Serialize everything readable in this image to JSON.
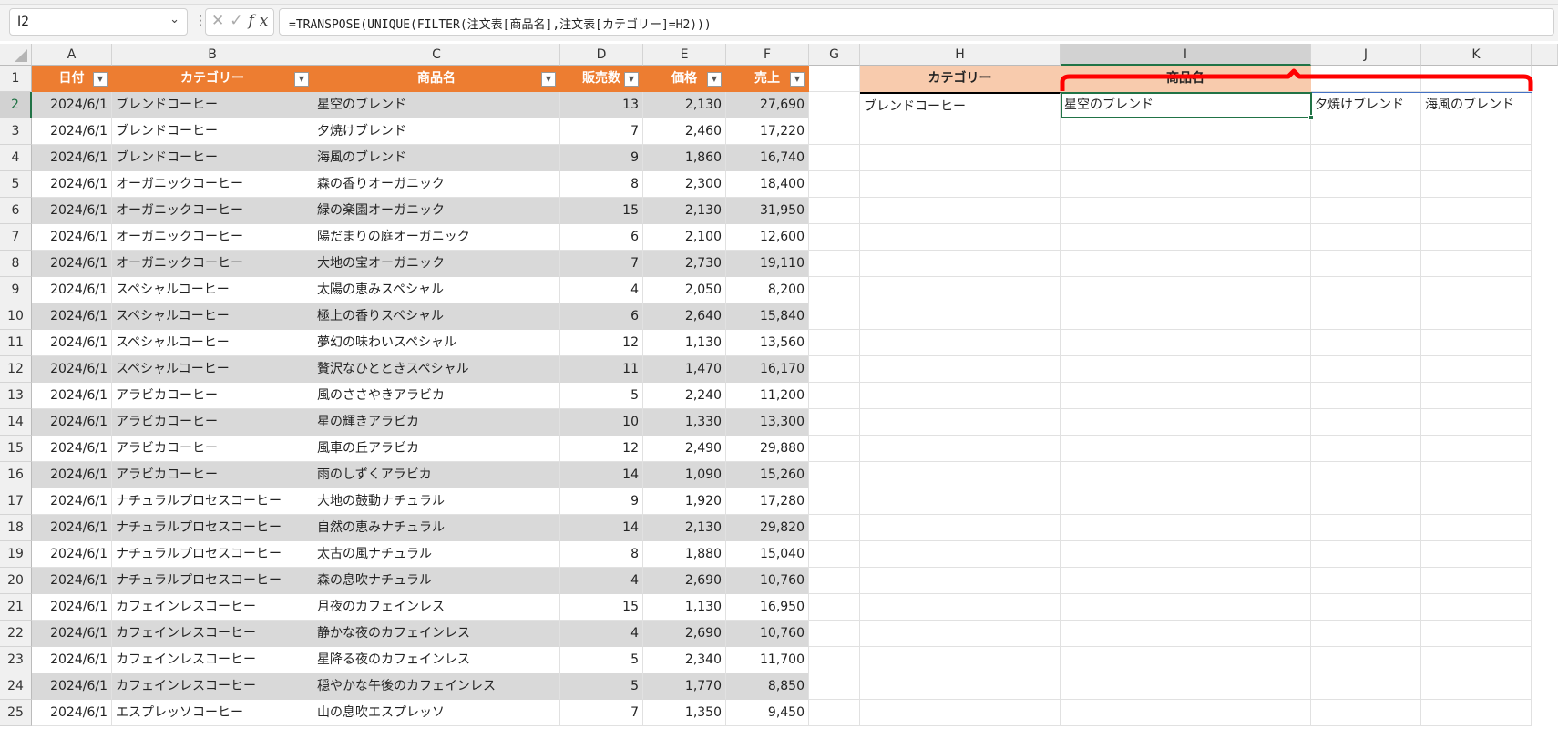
{
  "formula_bar": {
    "name_box": "I2",
    "formula": "=TRANSPOSE(UNIQUE(FILTER(注文表[商品名],注文表[カテゴリー]=H2)))",
    "fx": "fx"
  },
  "columns": [
    "A",
    "B",
    "C",
    "D",
    "E",
    "F",
    "G",
    "H",
    "I",
    "J",
    "K"
  ],
  "table": {
    "headers": [
      "日付",
      "カテゴリー",
      "商品名",
      "販売数",
      "価格",
      "売上"
    ],
    "rows": [
      [
        "2024/6/1",
        "ブレンドコーヒー",
        "星空のブレンド",
        "13",
        "2,130",
        "27,690"
      ],
      [
        "2024/6/1",
        "ブレンドコーヒー",
        "夕焼けブレンド",
        "7",
        "2,460",
        "17,220"
      ],
      [
        "2024/6/1",
        "ブレンドコーヒー",
        "海風のブレンド",
        "9",
        "1,860",
        "16,740"
      ],
      [
        "2024/6/1",
        "オーガニックコーヒー",
        "森の香りオーガニック",
        "8",
        "2,300",
        "18,400"
      ],
      [
        "2024/6/1",
        "オーガニックコーヒー",
        "緑の楽園オーガニック",
        "15",
        "2,130",
        "31,950"
      ],
      [
        "2024/6/1",
        "オーガニックコーヒー",
        "陽だまりの庭オーガニック",
        "6",
        "2,100",
        "12,600"
      ],
      [
        "2024/6/1",
        "オーガニックコーヒー",
        "大地の宝オーガニック",
        "7",
        "2,730",
        "19,110"
      ],
      [
        "2024/6/1",
        "スペシャルコーヒー",
        "太陽の恵みスペシャル",
        "4",
        "2,050",
        "8,200"
      ],
      [
        "2024/6/1",
        "スペシャルコーヒー",
        "極上の香りスペシャル",
        "6",
        "2,640",
        "15,840"
      ],
      [
        "2024/6/1",
        "スペシャルコーヒー",
        "夢幻の味わいスペシャル",
        "12",
        "1,130",
        "13,560"
      ],
      [
        "2024/6/1",
        "スペシャルコーヒー",
        "贅沢なひとときスペシャル",
        "11",
        "1,470",
        "16,170"
      ],
      [
        "2024/6/1",
        "アラビカコーヒー",
        "風のささやきアラビカ",
        "5",
        "2,240",
        "11,200"
      ],
      [
        "2024/6/1",
        "アラビカコーヒー",
        "星の輝きアラビカ",
        "10",
        "1,330",
        "13,300"
      ],
      [
        "2024/6/1",
        "アラビカコーヒー",
        "風車の丘アラビカ",
        "12",
        "2,490",
        "29,880"
      ],
      [
        "2024/6/1",
        "アラビカコーヒー",
        "雨のしずくアラビカ",
        "14",
        "1,090",
        "15,260"
      ],
      [
        "2024/6/1",
        "ナチュラルプロセスコーヒー",
        "大地の鼓動ナチュラル",
        "9",
        "1,920",
        "17,280"
      ],
      [
        "2024/6/1",
        "ナチュラルプロセスコーヒー",
        "自然の恵みナチュラル",
        "14",
        "2,130",
        "29,820"
      ],
      [
        "2024/6/1",
        "ナチュラルプロセスコーヒー",
        "太古の風ナチュラル",
        "8",
        "1,880",
        "15,040"
      ],
      [
        "2024/6/1",
        "ナチュラルプロセスコーヒー",
        "森の息吹ナチュラル",
        "4",
        "2,690",
        "10,760"
      ],
      [
        "2024/6/1",
        "カフェインレスコーヒー",
        "月夜のカフェインレス",
        "15",
        "1,130",
        "16,950"
      ],
      [
        "2024/6/1",
        "カフェインレスコーヒー",
        "静かな夜のカフェインレス",
        "4",
        "2,690",
        "10,760"
      ],
      [
        "2024/6/1",
        "カフェインレスコーヒー",
        "星降る夜のカフェインレス",
        "5",
        "2,340",
        "11,700"
      ],
      [
        "2024/6/1",
        "カフェインレスコーヒー",
        "穏やかな午後のカフェインレス",
        "5",
        "1,770",
        "8,850"
      ],
      [
        "2024/6/1",
        "エスプレッソコーヒー",
        "山の息吹エスプレッソ",
        "7",
        "1,350",
        "9,450"
      ]
    ]
  },
  "lookup": {
    "headers": [
      "カテゴリー",
      "商品名"
    ],
    "category": "ブレンドコーヒー",
    "results": [
      "星空のブレンド",
      "夕焼けブレンド",
      "海風のブレンド"
    ]
  },
  "colors": {
    "table_header": "#ed7d31",
    "band": "#d9d9d9",
    "lookup_header": "#f8cbad",
    "selection": "#217346",
    "annotation": "#ff0000"
  }
}
